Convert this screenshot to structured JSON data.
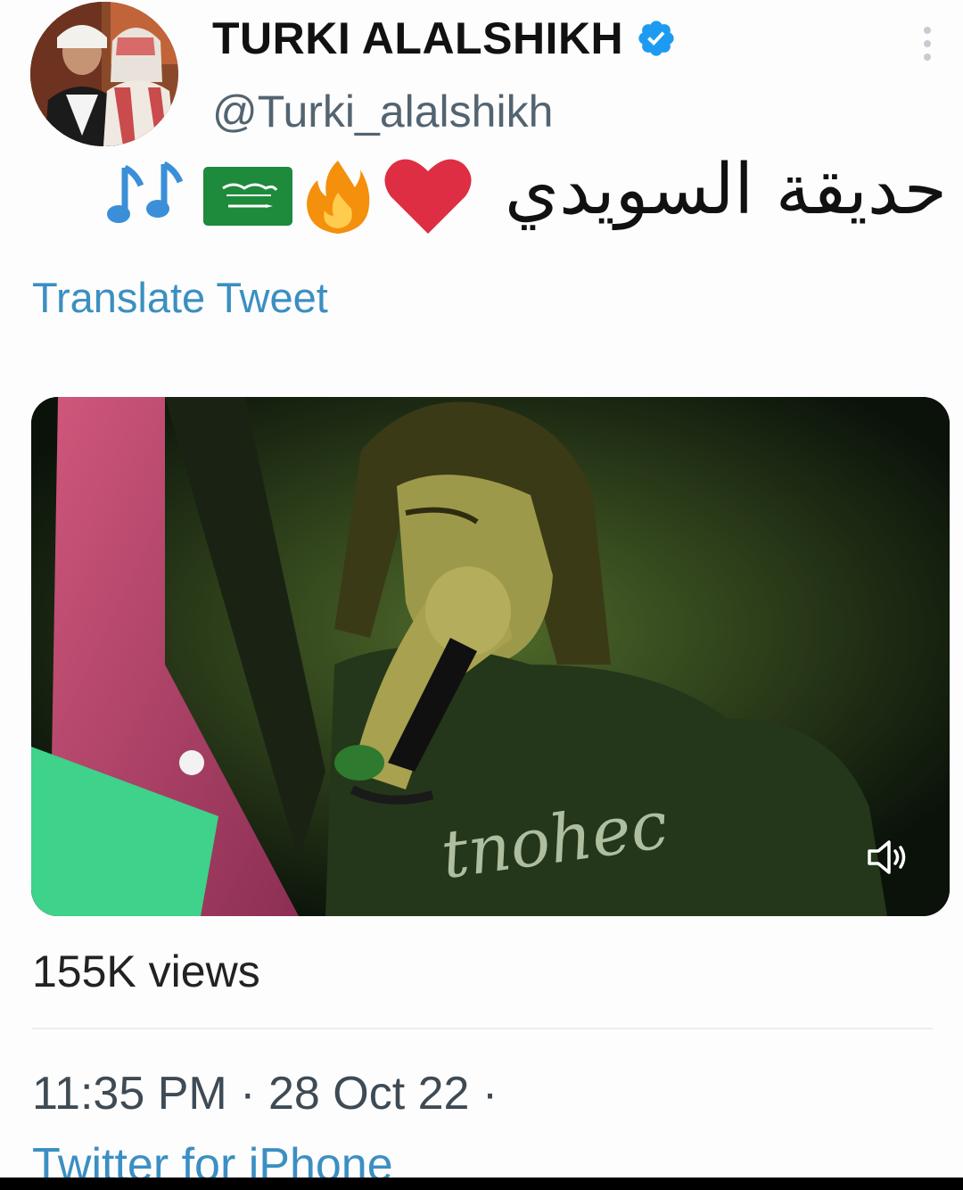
{
  "author": {
    "display_name": "TURKI ALALSHIKH",
    "handle": "@Turki_alalshikh",
    "verified": true
  },
  "tweet": {
    "text": "حديقة السويدي",
    "emoji_icons": [
      "red-heart-icon",
      "fire-icon",
      "saudi-flag-icon",
      "musical-notes-icon"
    ],
    "translate_label": "Translate Tweet"
  },
  "media": {
    "type": "video",
    "shirt_text": "tnohec"
  },
  "stats": {
    "views": "155K views",
    "time": "11:35 PM",
    "separator": "·",
    "date": "28 Oct 22",
    "trailing_separator": "·",
    "source": "Twitter for iPhone"
  },
  "colors": {
    "link": "#3b8fc2",
    "verified": "#1d9bf0",
    "text": "#0f1419",
    "muted": "#536471"
  }
}
